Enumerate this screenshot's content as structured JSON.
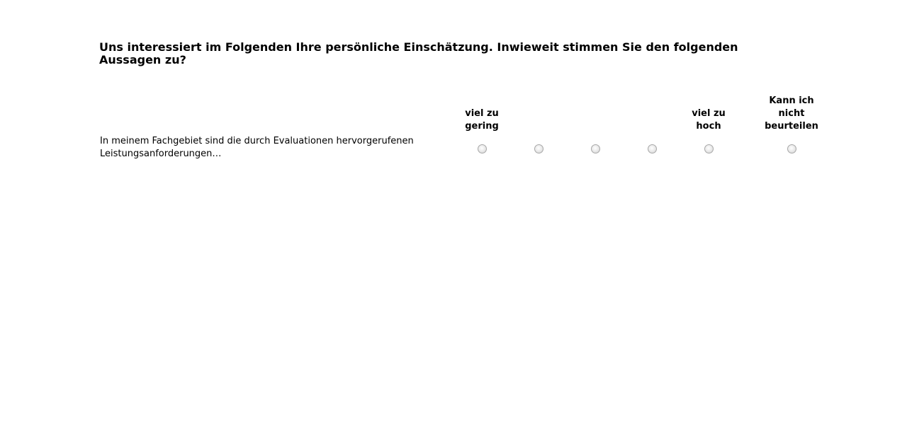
{
  "question": {
    "title": "Uns interessiert im Folgenden Ihre persönliche Einschätzung. Inwieweit stimmen Sie den folgenden Aussagen zu?"
  },
  "scale": {
    "columns": [
      {
        "label": "viel zu\ngering"
      },
      {
        "label": ""
      },
      {
        "label": ""
      },
      {
        "label": ""
      },
      {
        "label": "viel zu\nhoch"
      },
      {
        "label": "Kann ich\nnicht\nbeurteilen"
      }
    ]
  },
  "rows": [
    {
      "statement": "In meinem Fachgebiet sind die durch Evaluationen hervorgerufenen Leistungsanforderungen…",
      "selected": null
    }
  ]
}
